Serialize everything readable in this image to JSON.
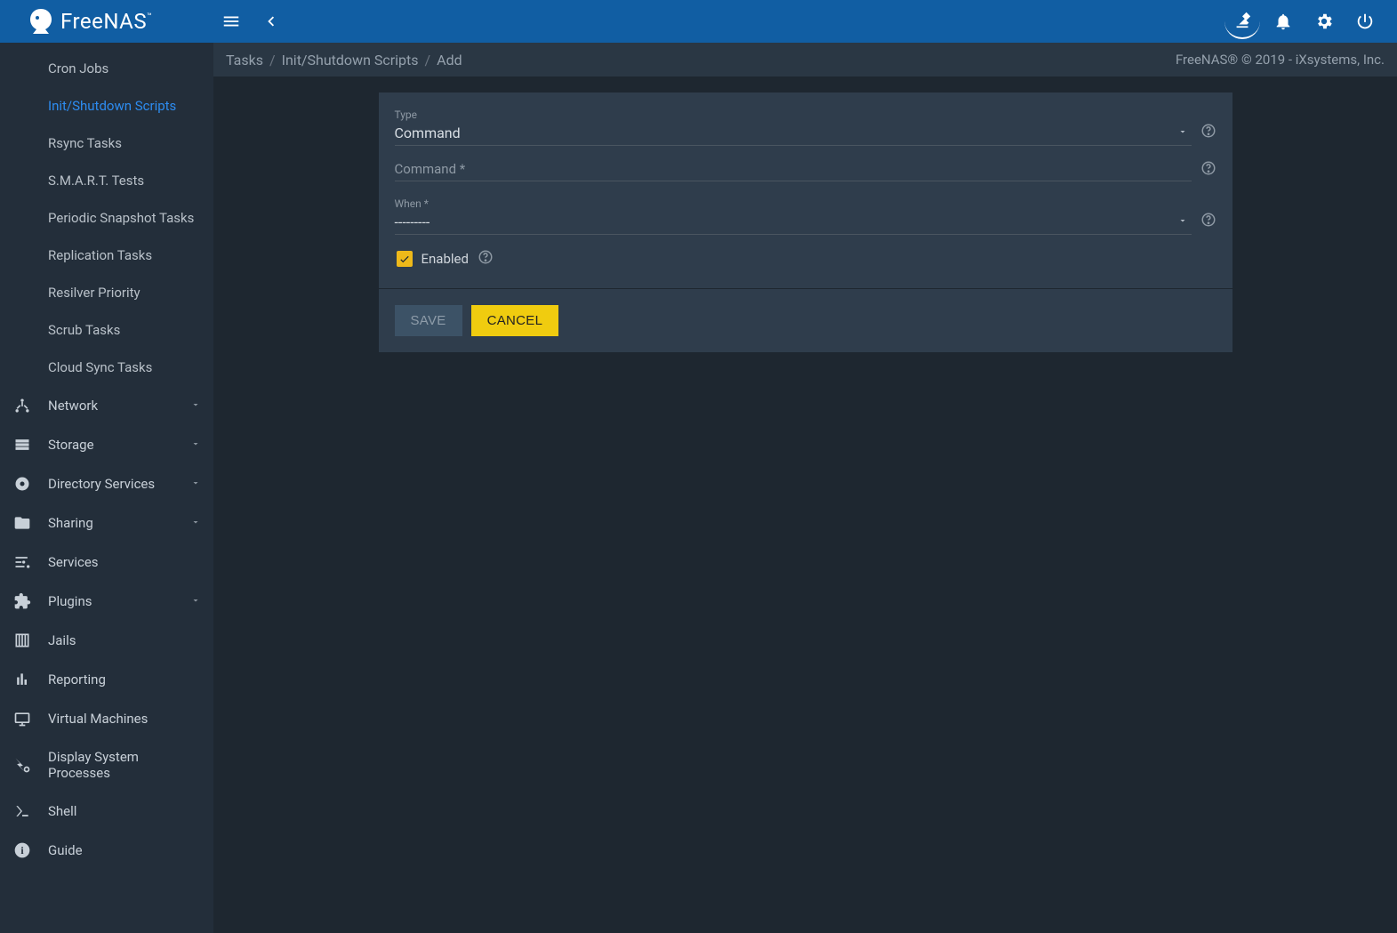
{
  "app": {
    "name": "FreeNAS"
  },
  "breadcrumb": {
    "items": [
      "Tasks",
      "Init/Shutdown Scripts",
      "Add"
    ],
    "copyright": "FreeNAS® © 2019 - iXsystems, Inc."
  },
  "sidebar": {
    "sub_items": [
      {
        "label": "Cron Jobs",
        "active": false
      },
      {
        "label": "Init/Shutdown Scripts",
        "active": true
      },
      {
        "label": "Rsync Tasks",
        "active": false
      },
      {
        "label": "S.M.A.R.T. Tests",
        "active": false
      },
      {
        "label": "Periodic Snapshot Tasks",
        "active": false
      },
      {
        "label": "Replication Tasks",
        "active": false
      },
      {
        "label": "Resilver Priority",
        "active": false
      },
      {
        "label": "Scrub Tasks",
        "active": false
      },
      {
        "label": "Cloud Sync Tasks",
        "active": false
      }
    ],
    "items": [
      {
        "icon": "network",
        "label": "Network",
        "expandable": true
      },
      {
        "icon": "storage",
        "label": "Storage",
        "expandable": true
      },
      {
        "icon": "directory",
        "label": "Directory Services",
        "expandable": true
      },
      {
        "icon": "sharing",
        "label": "Sharing",
        "expandable": true
      },
      {
        "icon": "services",
        "label": "Services",
        "expandable": false
      },
      {
        "icon": "plugins",
        "label": "Plugins",
        "expandable": true
      },
      {
        "icon": "jails",
        "label": "Jails",
        "expandable": false
      },
      {
        "icon": "reporting",
        "label": "Reporting",
        "expandable": false
      },
      {
        "icon": "vm",
        "label": "Virtual Machines",
        "expandable": false
      },
      {
        "icon": "processes",
        "label": "Display System Processes",
        "expandable": false
      },
      {
        "icon": "shell",
        "label": "Shell",
        "expandable": false
      },
      {
        "icon": "guide",
        "label": "Guide",
        "expandable": false
      }
    ]
  },
  "form": {
    "type_label": "Type",
    "type_value": "Command",
    "command_label": "Command *",
    "when_label": "When *",
    "when_value": "---------",
    "enabled_label": "Enabled",
    "enabled_checked": true,
    "save_label": "SAVE",
    "cancel_label": "CANCEL"
  }
}
